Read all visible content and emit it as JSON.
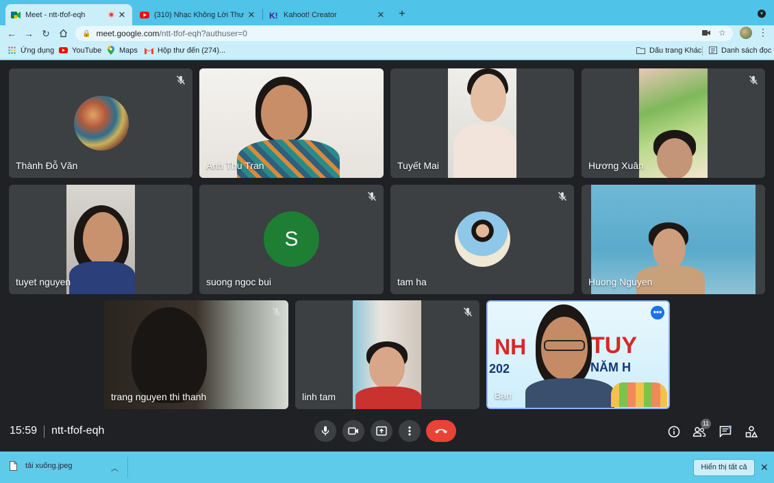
{
  "browser": {
    "tabs": [
      {
        "title": "Meet - ntt-tfof-eqh",
        "active": true,
        "recording": true
      },
      {
        "title": "(310) Nhạc Không Lời Thư Giãn",
        "active": false
      },
      {
        "title": "Kahoot! Creator",
        "active": false
      }
    ],
    "url_host": "meet.google.com",
    "url_path": "/ntt-tfof-eqh?authuser=0",
    "bookmarks": [
      {
        "label": "Ứng dụng",
        "icon": "apps-grid-icon"
      },
      {
        "label": "YouTube",
        "icon": "youtube-icon"
      },
      {
        "label": "Maps",
        "icon": "maps-pin-icon"
      },
      {
        "label": "Hộp thư đến (274)...",
        "icon": "gmail-icon"
      }
    ],
    "bookmarks_right": [
      {
        "label": "Dấu trang Khác",
        "icon": "folder-icon"
      },
      {
        "label": "Danh sách đọc",
        "icon": "reading-list-icon"
      }
    ]
  },
  "participants": [
    {
      "name": "Thành Đỗ Văn",
      "muted": true
    },
    {
      "name": "Anh Thu Tran",
      "muted": false
    },
    {
      "name": "Tuyết Mai",
      "muted": false
    },
    {
      "name": "Hương Xuân",
      "muted": true
    },
    {
      "name": "tuyet nguyen",
      "muted": false
    },
    {
      "name": "suong ngoc bui",
      "muted": true,
      "initial": "S"
    },
    {
      "name": "tam ha",
      "muted": true
    },
    {
      "name": "Huong Nguyen",
      "muted": false
    },
    {
      "name": "trang nguyen thi thanh",
      "muted": true
    },
    {
      "name": "linh tam",
      "muted": true
    },
    {
      "name": "Bạn",
      "muted": false,
      "self": true,
      "banner_text_1": "TUY",
      "banner_text_2": "NĂM H",
      "banner_text_3": "202",
      "banner_text_4": "NH"
    }
  ],
  "meeting": {
    "time": "15:59",
    "code": "ntt-tfof-eqh",
    "participant_count": "11"
  },
  "downloads": {
    "file": "tải xuống.jpeg",
    "show_all": "Hiển thị tất cả"
  },
  "colors": {
    "chrome_tab_bar": "#4fc3e8",
    "chrome_toolbar": "#cbeefb",
    "meet_bg": "#202124",
    "tile_bg": "#3c4043",
    "end_call": "#ea4335",
    "avatar_green": "#1e7e34",
    "active_speaker_border": "#8ab4f8"
  }
}
